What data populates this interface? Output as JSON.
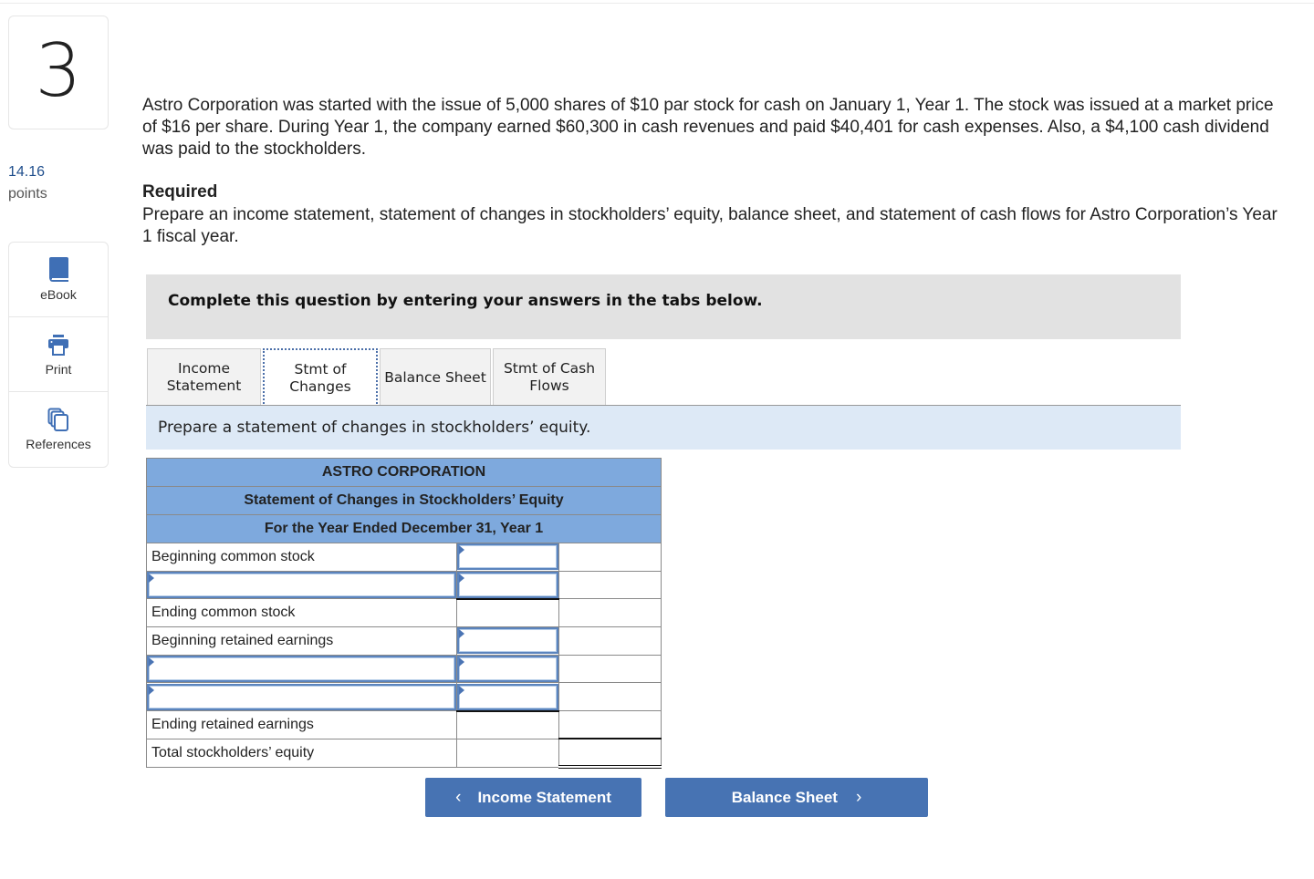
{
  "question": {
    "number": "3",
    "points_value": "14.16",
    "points_label": "points"
  },
  "tools": [
    {
      "label": "eBook",
      "icon": "book-icon"
    },
    {
      "label": "Print",
      "icon": "printer-icon"
    },
    {
      "label": "References",
      "icon": "documents-icon"
    }
  ],
  "prompt": "Astro Corporation was started with the issue of 5,000 shares of $10 par stock for cash on January 1, Year 1. The stock was issued at a market price of $16 per share. During Year 1, the company earned $60,300 in cash revenues and paid $40,401 for cash expenses. Also, a $4,100 cash dividend was paid to the stockholders.",
  "required": {
    "title": "Required",
    "text": "Prepare an income statement, statement of changes in stockholders’ equity, balance sheet, and statement of cash flows for Astro Corporation’s Year 1 fiscal year."
  },
  "instruction": "Complete this question by entering your answers in the tabs below.",
  "tabs": [
    {
      "label_line1": "Income",
      "label_line2": "Statement",
      "active": false
    },
    {
      "label_line1": "Stmt of",
      "label_line2": "Changes",
      "active": true
    },
    {
      "label_line1": "Balance Sheet",
      "label_line2": "",
      "active": false
    },
    {
      "label_line1": "Stmt of Cash",
      "label_line2": "Flows",
      "active": false
    }
  ],
  "subprompt": "Prepare a statement of changes in stockholders’ equity.",
  "statement": {
    "company": "ASTRO CORPORATION",
    "title": "Statement of Changes in Stockholders’ Equity",
    "period": "For the Year Ended December 31, Year 1",
    "rows": [
      {
        "label": "Beginning common stock",
        "label_input": false,
        "amount_input": true,
        "amount": "",
        "total": ""
      },
      {
        "label": "",
        "label_input": true,
        "amount_input": true,
        "amount": "",
        "total": ""
      },
      {
        "label": "Ending common stock",
        "label_input": false,
        "amount_input": false,
        "amount": "",
        "total": ""
      },
      {
        "label": "Beginning retained earnings",
        "label_input": false,
        "amount_input": true,
        "amount": "",
        "total": ""
      },
      {
        "label": "",
        "label_input": true,
        "amount_input": true,
        "amount": "",
        "total": ""
      },
      {
        "label": "",
        "label_input": true,
        "amount_input": true,
        "amount": "",
        "total": ""
      },
      {
        "label": "Ending retained earnings",
        "label_input": false,
        "amount_input": false,
        "amount": "",
        "total": ""
      },
      {
        "label": "Total stockholders’ equity",
        "label_input": false,
        "amount_input": false,
        "amount": "",
        "total": ""
      }
    ]
  },
  "navigation": {
    "prev_label": "Income Statement",
    "prev_icon": "‹",
    "next_label": "Balance Sheet",
    "next_icon": "›"
  },
  "colors": {
    "accent": "#4773b3",
    "header_fill": "#7ea9dd",
    "subprompt_bg": "#dde9f6",
    "instruction_bg": "#e2e2e2",
    "points": "#1f4e8c"
  }
}
